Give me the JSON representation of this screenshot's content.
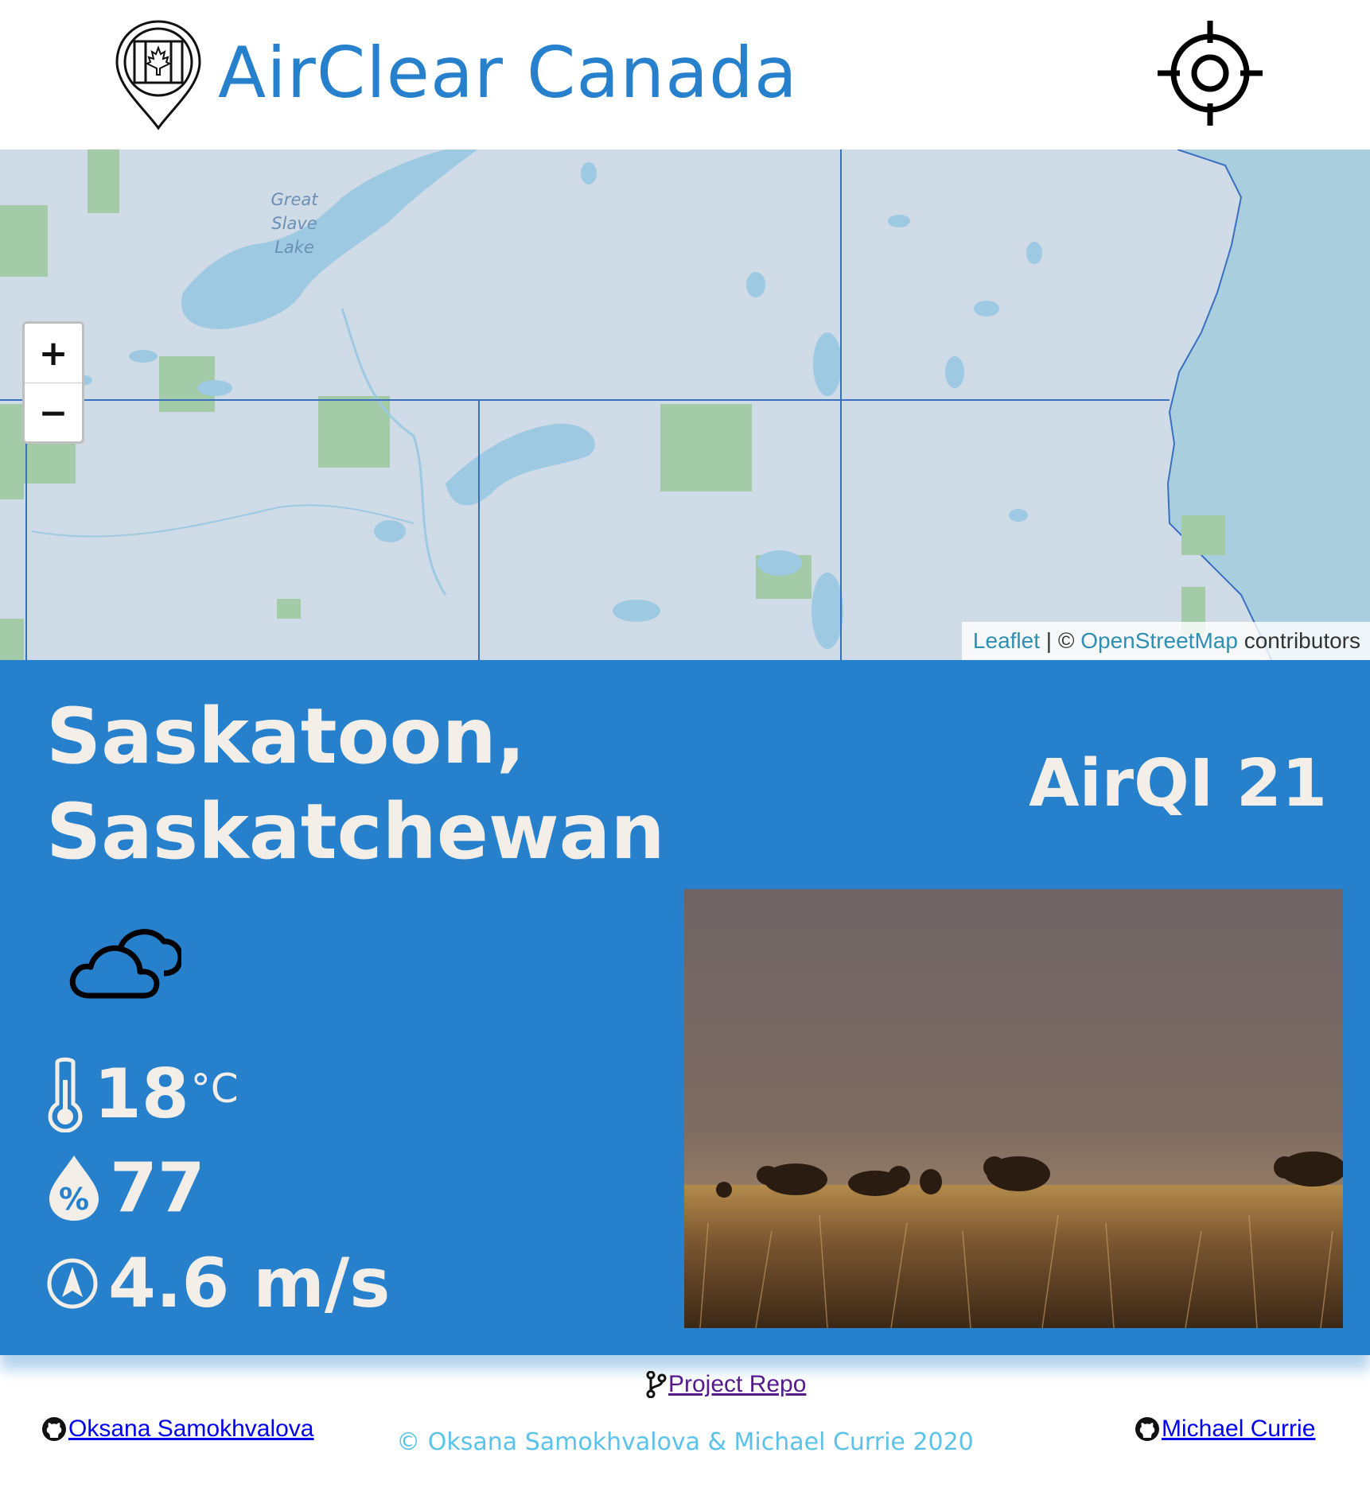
{
  "header": {
    "brand": "AirClear Canada",
    "logo_icon": "map-pin-canada-flag-icon",
    "locate_icon": "crosshair-locate-icon"
  },
  "map": {
    "lake_label": "Great Slave Lake",
    "zoom_in": "+",
    "zoom_out": "−",
    "attribution": {
      "leaflet": "Leaflet",
      "separator": "| ©",
      "osm": "OpenStreetMap",
      "suffix": "contributors"
    }
  },
  "location": {
    "line1": "Saskatoon,",
    "line2": "Saskatchewan",
    "aqi": "AirQI 21"
  },
  "weather": {
    "condition_icon": "cloudy-icon",
    "temperature": "18",
    "temperature_unit": "°C",
    "humidity": "77",
    "wind": "4.6 m/s"
  },
  "footer": {
    "repo": "Project Repo",
    "author1": "Oksana Samokhvalova",
    "author2": "Michael Currie",
    "copyright": "© Oksana Samokhvalova & Michael Currie 2020"
  },
  "colors": {
    "brand_blue": "#2680cc",
    "panel_text": "#f3efe8",
    "map_water": "#9ec9e2",
    "map_land": "#cfdbe6",
    "map_park": "#a3cba8",
    "copyright": "#5bc2ea"
  }
}
